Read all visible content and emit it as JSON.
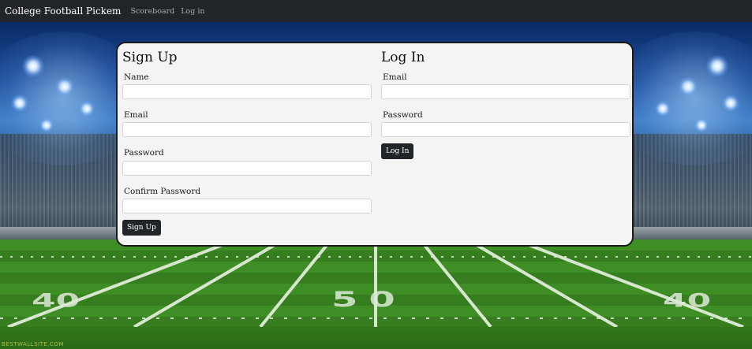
{
  "navbar": {
    "brand": "College Football Pickem",
    "links": [
      "Scoreboard",
      "Log in"
    ]
  },
  "signup": {
    "title": "Sign Up",
    "fields": {
      "name": {
        "label": "Name",
        "value": "",
        "placeholder": ""
      },
      "email": {
        "label": "Email",
        "value": "",
        "placeholder": ""
      },
      "password": {
        "label": "Password",
        "value": "",
        "placeholder": ""
      },
      "confirm_password": {
        "label": "Confirm Password",
        "value": "",
        "placeholder": ""
      }
    },
    "button_label": "Sign Up"
  },
  "login": {
    "title": "Log In",
    "fields": {
      "email": {
        "label": "Email",
        "value": "",
        "placeholder": ""
      },
      "password": {
        "label": "Password",
        "value": "",
        "placeholder": ""
      }
    },
    "button_label": "Log In"
  },
  "background": {
    "yard_numbers": [
      "40",
      "50",
      "40"
    ],
    "watermark": "BESTWALLSITE.COM"
  },
  "colors": {
    "navbar_bg": "#212529",
    "card_bg": "#f4f4f4",
    "button_bg": "#212529",
    "field_green": "#3e8e25"
  }
}
